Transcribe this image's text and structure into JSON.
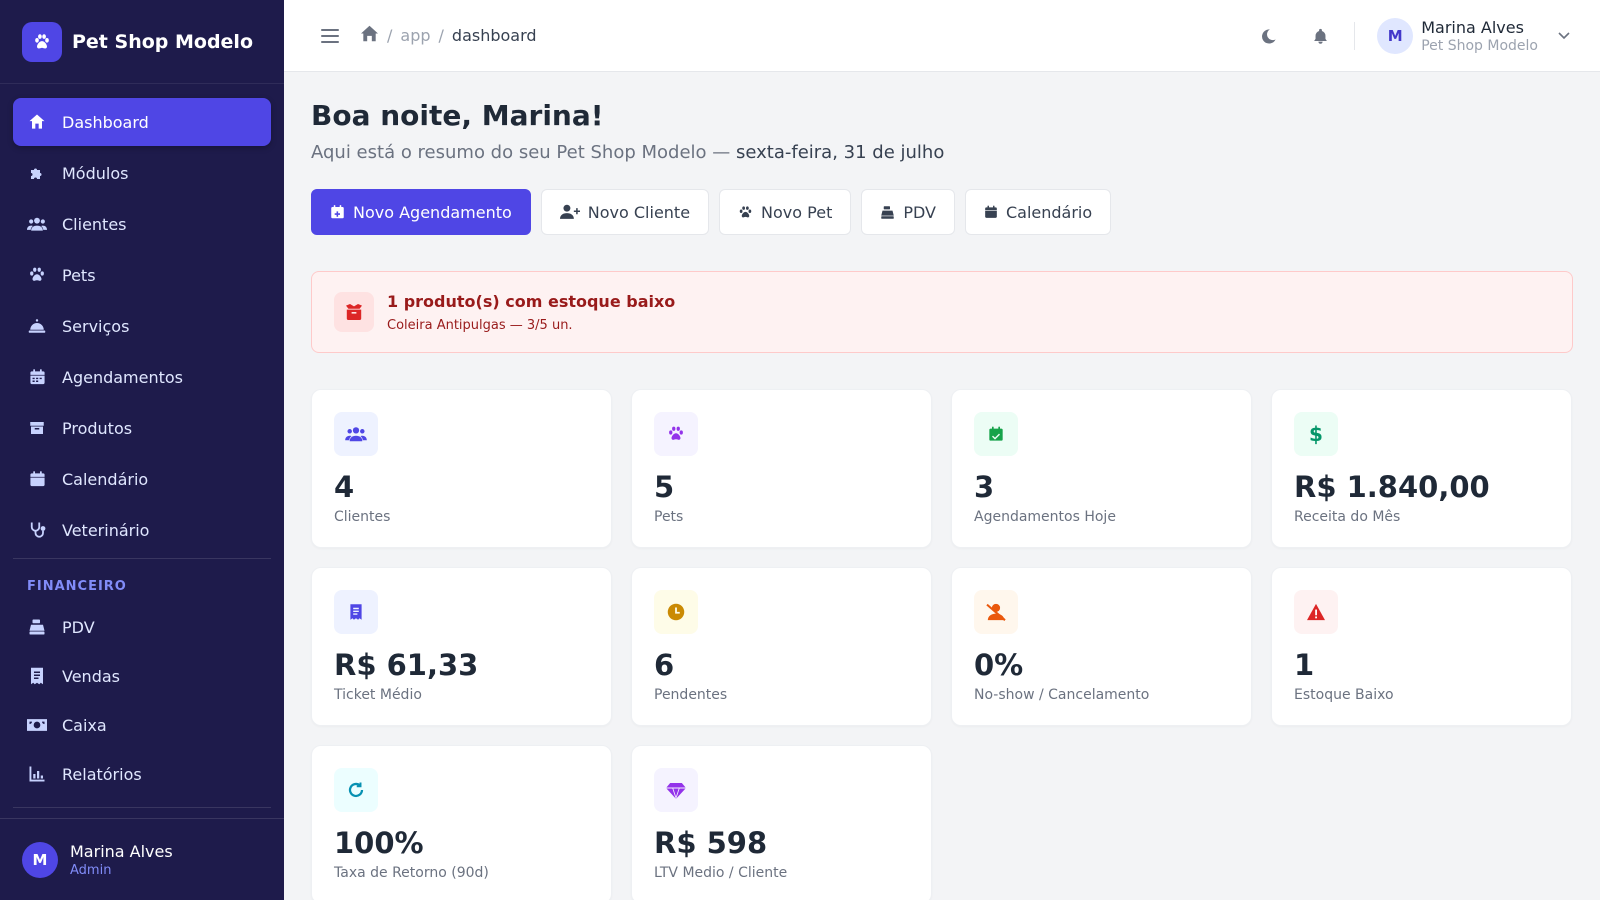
{
  "brand": {
    "name": "Pet Shop Modelo",
    "icon": "paw-icon"
  },
  "sidebar": {
    "items": [
      {
        "label": "Dashboard",
        "icon": "home-icon",
        "active": true
      },
      {
        "label": "Módulos",
        "icon": "puzzle-icon"
      },
      {
        "label": "Clientes",
        "icon": "users-icon"
      },
      {
        "label": "Pets",
        "icon": "paw-icon"
      },
      {
        "label": "Serviços",
        "icon": "bell-service-icon"
      },
      {
        "label": "Agendamentos",
        "icon": "calendar-icon"
      },
      {
        "label": "Produtos",
        "icon": "box-icon"
      },
      {
        "label": "Calendário",
        "icon": "calendar-icon"
      },
      {
        "label": "Veterinário",
        "icon": "stethoscope-icon"
      }
    ],
    "section_financeiro": "FINANCEIRO",
    "fin_items": [
      {
        "label": "PDV",
        "icon": "cash-register-icon"
      },
      {
        "label": "Vendas",
        "icon": "receipt-icon"
      },
      {
        "label": "Caixa",
        "icon": "money-icon"
      },
      {
        "label": "Relatórios",
        "icon": "chart-icon"
      }
    ],
    "user": {
      "initial": "M",
      "name": "Marina Alves",
      "role": "Admin"
    }
  },
  "topbar": {
    "breadcrumb": [
      "app",
      "dashboard"
    ],
    "separator": "/",
    "user": {
      "initial": "M",
      "name": "Marina Alves",
      "sub": "Pet Shop Modelo"
    }
  },
  "main": {
    "greeting": "Boa noite, Marina!",
    "subtitle_prefix": "Aqui está o resumo do seu Pet Shop Modelo —",
    "subtitle_date": "sexta-feira, 31 de julho",
    "actions": [
      {
        "label": "Novo Agendamento",
        "icon": "calendar-plus-icon",
        "primary": true
      },
      {
        "label": "Novo Cliente",
        "icon": "user-plus-icon"
      },
      {
        "label": "Novo Pet",
        "icon": "paw-icon"
      },
      {
        "label": "PDV",
        "icon": "cash-register-icon"
      },
      {
        "label": "Calendário",
        "icon": "calendar-icon"
      }
    ],
    "alert": {
      "title": "1 produto(s) com estoque baixo",
      "text": "Coleira Antipulgas — 3/5 un.",
      "icon": "box-open-icon"
    },
    "cards": [
      {
        "value": "4",
        "label": "Clientes",
        "icon": "users-icon",
        "bg": "#eef2ff",
        "fg": "#4f46e5"
      },
      {
        "value": "5",
        "label": "Pets",
        "icon": "paw-icon",
        "bg": "#f5f3ff",
        "fg": "#9333ea"
      },
      {
        "value": "3",
        "label": "Agendamentos Hoje",
        "icon": "calendar-check-icon",
        "bg": "#ecfdf5",
        "fg": "#16a34a"
      },
      {
        "value": "R$ 1.840,00",
        "label": "Receita do Mês",
        "icon": "dollar-icon",
        "bg": "#ecfdf5",
        "fg": "#059669"
      },
      {
        "value": "R$ 61,33",
        "label": "Ticket Médio",
        "icon": "receipt-icon",
        "bg": "#eef2ff",
        "fg": "#4f46e5"
      },
      {
        "value": "6",
        "label": "Pendentes",
        "icon": "clock-icon",
        "bg": "#fefce8",
        "fg": "#ca8a04"
      },
      {
        "value": "0%",
        "label": "No-show / Cancelamento",
        "icon": "user-slash-icon",
        "bg": "#fff7ed",
        "fg": "#ea580c"
      },
      {
        "value": "1",
        "label": "Estoque Baixo",
        "icon": "warning-icon",
        "bg": "#fef2f2",
        "fg": "#dc2626"
      },
      {
        "value": "100%",
        "label": "Taxa de Retorno (90d)",
        "icon": "refresh-icon",
        "bg": "#ecfeff",
        "fg": "#0891b2"
      },
      {
        "value": "R$ 598",
        "label": "LTV Medio / Cliente",
        "icon": "gem-icon",
        "bg": "#f5f3ff",
        "fg": "#9333ea"
      }
    ]
  },
  "colors": {
    "sidebar_bg": "#1e1b4b",
    "accent": "#4f46e5",
    "alert_bg": "#fef2f2",
    "alert_text": "#991b1b"
  }
}
